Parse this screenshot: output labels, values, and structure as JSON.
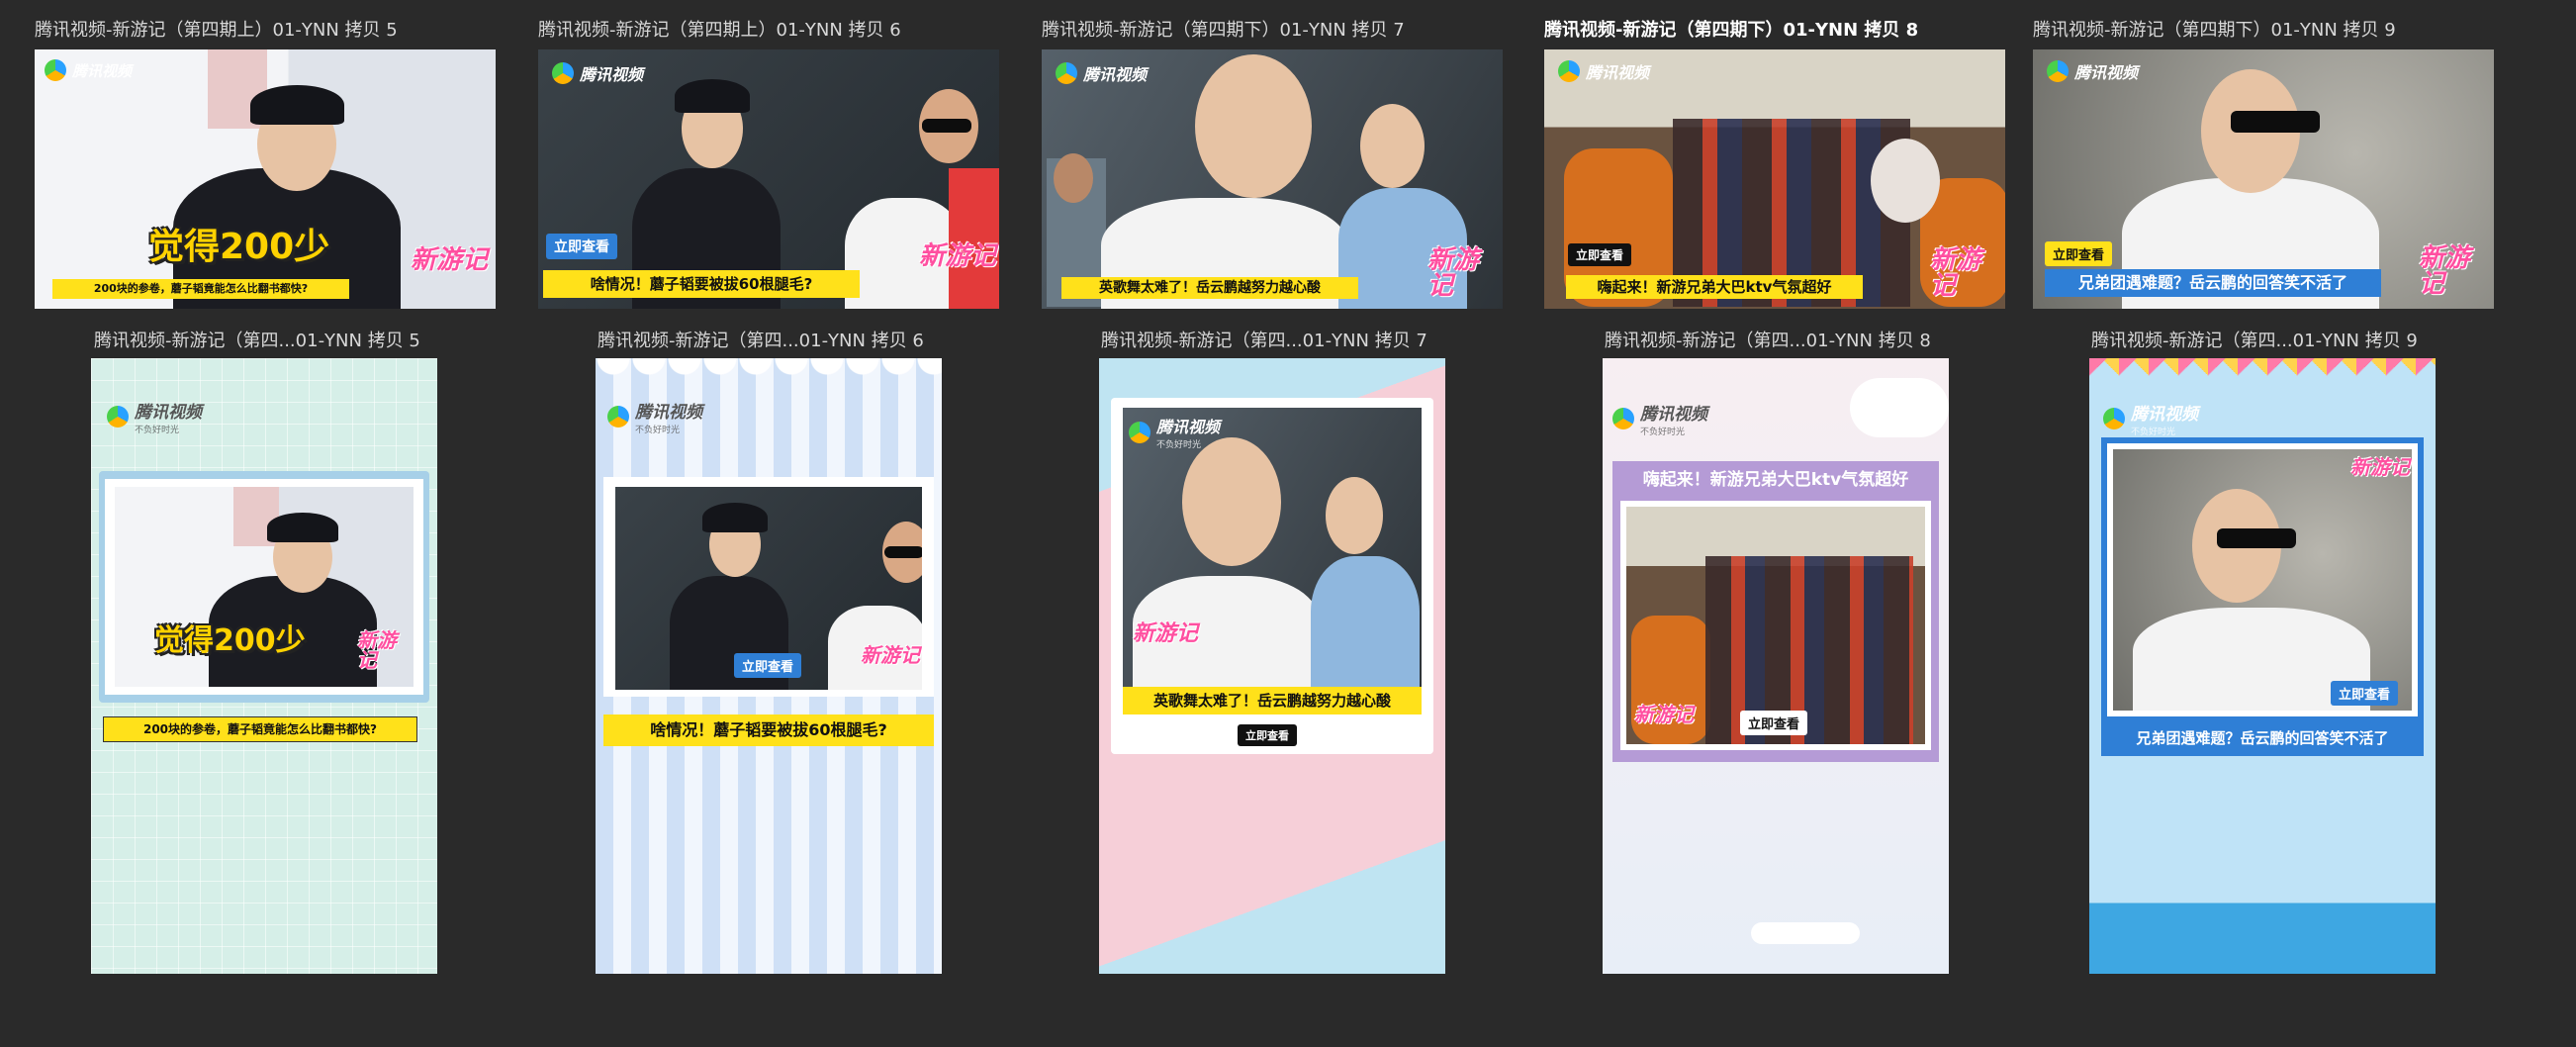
{
  "artboards_top": [
    {
      "label": "腾讯视频-新游记（第四期上）01-YNN 拷贝 5"
    },
    {
      "label": "腾讯视频-新游记（第四期上）01-YNN 拷贝 6"
    },
    {
      "label": "腾讯视频-新游记（第四期下）01-YNN 拷贝 7"
    },
    {
      "label": "腾讯视频-新游记（第四期下）01-YNN 拷贝 8"
    },
    {
      "label": "腾讯视频-新游记（第四期下）01-YNN 拷贝 9"
    }
  ],
  "artboards_bottom": [
    {
      "label": "腾讯视频-新游记（第四...01-YNN 拷贝 5"
    },
    {
      "label": "腾讯视频-新游记（第四...01-YNN 拷贝 6"
    },
    {
      "label": "腾讯视频-新游记（第四...01-YNN 拷贝 7"
    },
    {
      "label": "腾讯视频-新游记（第四...01-YNN 拷贝 8"
    },
    {
      "label": "腾讯视频-新游记（第四...01-YNN 拷贝 9"
    }
  ],
  "brand": {
    "name": "腾讯视频",
    "slogan": "不负好时光",
    "show": "新游记"
  },
  "cta": "立即查看",
  "texts": {
    "big_1": "觉得200少",
    "caption_1": "200块的参卷，蘑子韬竟能怎么比翻书都快?",
    "caption_2": "啥情况！蘑子韬要被拔60根腿毛?",
    "caption_3": "英歌舞太难了！岳云鹏越努力越心酸",
    "caption_4": "嗨起来！新游兄弟大巴ktv气氛超好",
    "caption_5": "兄弟团遇难题？岳云鹏的回答笑不活了"
  },
  "colors": {
    "canvas": "#2a2a2a",
    "caption_bg": "#ffe11a",
    "cta_blue": "#2f7fd6",
    "show_pink": "#ff4fa0",
    "mint_bg": "#d6efe8",
    "stripe_blue": "#cfe0f6",
    "pink_bg": "#f6cfd8",
    "lavender_panel": "#b59bd6",
    "sky_bg": "#bfe3f7"
  }
}
